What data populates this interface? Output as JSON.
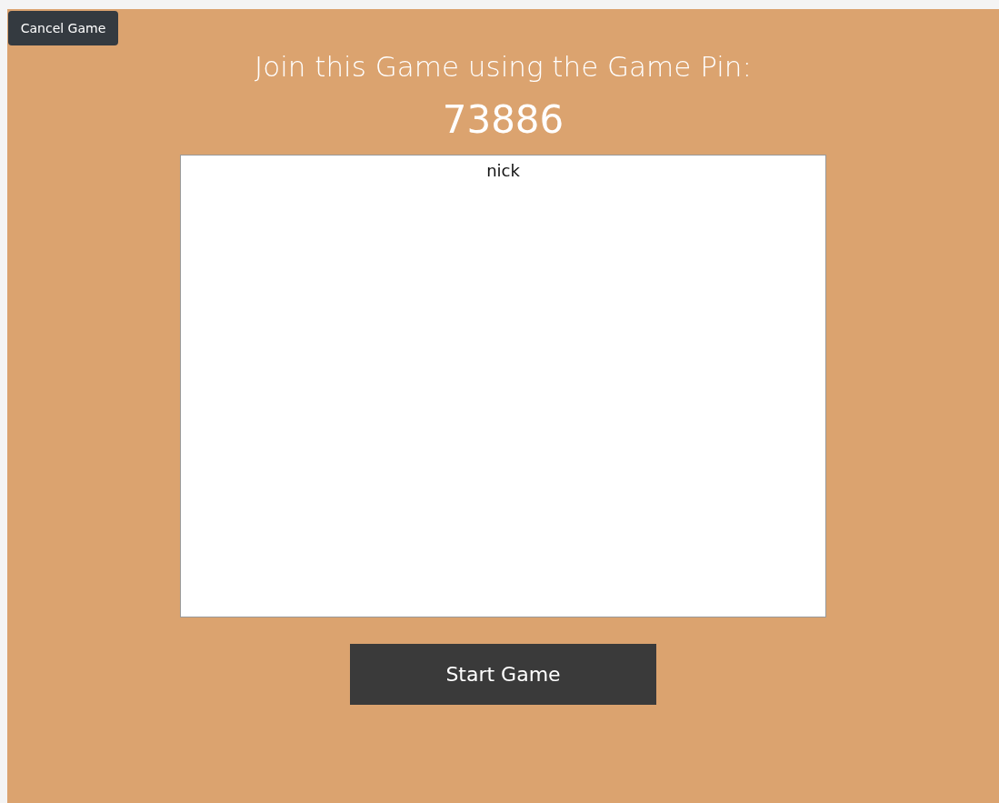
{
  "cancel_button": {
    "label": "Cancel Game"
  },
  "heading": "Join this Game using the Game Pin:",
  "game_pin": "73886",
  "players": [
    {
      "name": "nick"
    }
  ],
  "start_button": {
    "label": "Start Game"
  }
}
